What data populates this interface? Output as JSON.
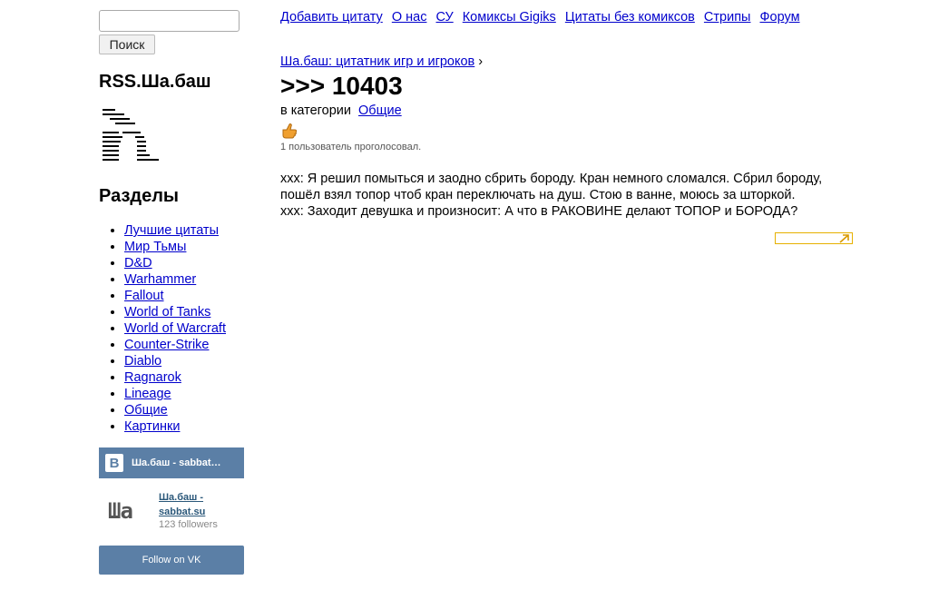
{
  "search": {
    "placeholder": "",
    "value": "",
    "button_label": "Поиск"
  },
  "sidebar": {
    "rss_title": "RSS.Ша.баш",
    "sections_title": "Разделы",
    "sections": [
      "Лучшие цитаты",
      "Мир Тьмы",
      "D&D",
      "Warhammer",
      "Fallout",
      "World of Tanks",
      "World of Warcraft",
      "Counter-Strike",
      "Diablo",
      "Ragnarok",
      "Lineage",
      "Общие",
      "Картинки"
    ]
  },
  "vk": {
    "header_title": "Ша.баш - sabbat.su",
    "avatar_text": "Ша",
    "group_name": "Ша.баш - sabbat.su",
    "followers": "123 followers",
    "follow_label": "Follow on VK"
  },
  "topnav": [
    "Добавить цитату",
    "О нас",
    "СУ",
    "Комиксы Gigiks",
    "Цитаты без комиксов",
    "Стрипы",
    "Форум"
  ],
  "main": {
    "breadcrumb_link": "Ша.баш: цитатник игр и игроков",
    "breadcrumb_sep": " ›",
    "title": ">>> 10403",
    "category_prefix": "в категории",
    "category": "Общие",
    "voted": "1 пользователь проголосовал.",
    "quote_lines": [
      "xxx: Я решил помыться и заодно сбрить бороду. Кран немного сломался. Сбрил бороду, пошёл взял топор чтоб кран переключать на душ. Стою в ванне, моюсь за шторкой.",
      "xxx: Заходит девушка и произносит: А что в РАКОВИНЕ делают ТОПОР и БОРОДА?"
    ]
  },
  "colors": {
    "link": "#0000cc",
    "vk_blue": "#5b7fa6",
    "accent_box": "#e6b100"
  }
}
